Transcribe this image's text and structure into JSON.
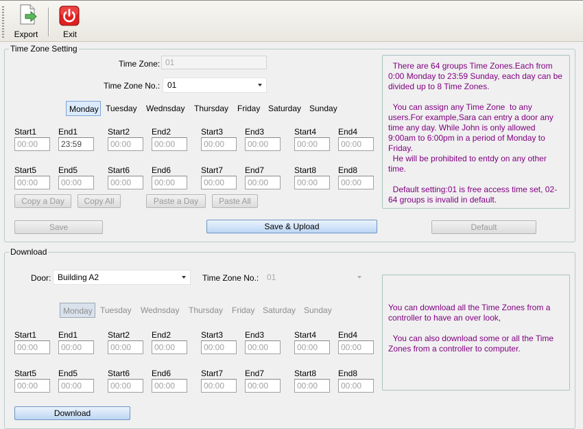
{
  "toolbar": {
    "export_label": "Export",
    "exit_label": "Exit"
  },
  "tz_setting": {
    "title": "Time Zone Setting",
    "time_zone_label": "Time Zone:",
    "time_zone_value": "01",
    "tz_no_label": "Time Zone No.:",
    "tz_no_value": "01",
    "days": [
      "Monday",
      "Tuesday",
      "Wednsday",
      "Thursday",
      "Friday",
      "Saturday",
      "Sunday"
    ],
    "selected_day": "Monday",
    "row1": [
      {
        "s_label": "Start1",
        "e_label": "End1",
        "s_value": "00:00",
        "e_value": "23:59"
      },
      {
        "s_label": "Start2",
        "e_label": "End2",
        "s_value": "00:00",
        "e_value": "00:00"
      },
      {
        "s_label": "Start3",
        "e_label": "End3",
        "s_value": "00:00",
        "e_value": "00:00"
      },
      {
        "s_label": "Start4",
        "e_label": "End4",
        "s_value": "00:00",
        "e_value": "00:00"
      }
    ],
    "row2": [
      {
        "s_label": "Start5",
        "e_label": "End5",
        "s_value": "00:00",
        "e_value": "00:00"
      },
      {
        "s_label": "Start6",
        "e_label": "End6",
        "s_value": "00:00",
        "e_value": "00:00"
      },
      {
        "s_label": "Start7",
        "e_label": "End7",
        "s_value": "00:00",
        "e_value": "00:00"
      },
      {
        "s_label": "Start8",
        "e_label": "End8",
        "s_value": "00:00",
        "e_value": "00:00"
      }
    ],
    "copy_day_label": "Copy a Day",
    "copy_all_label": "Copy All",
    "paste_day_label": "Paste a Day",
    "paste_all_label": "Paste All",
    "save_label": "Save",
    "save_upload_label": "Save & Upload",
    "default_label": "Default",
    "info_text": "  There are 64 groups Time Zones.Each from 0:00 Monday to 23:59 Sunday, each day can be divided up to 8 Time Zones.\n\n  You can assign any Time Zone  to any users.For example,Sara can entry a door any time any day. While John is only allowed 9:00am to 6:00pm in a period of Monday to Friday.\n  He will be prohibited to entdy on any other time.\n\n  Default setting:01 is free access time set, 02-64 groups is invalid in default."
  },
  "download": {
    "title": "Download",
    "door_label": "Door:",
    "door_value": "Building A2",
    "tz_no_label": "Time Zone No.:",
    "tz_no_value": "01",
    "days": [
      "Monday",
      "Tuesday",
      "Wednsday",
      "Thursday",
      "Friday",
      "Saturday",
      "Sunday"
    ],
    "selected_day": "Monday",
    "row1": [
      {
        "s_label": "Start1",
        "e_label": "End1",
        "s_value": "00:00",
        "e_value": "00:00"
      },
      {
        "s_label": "Start2",
        "e_label": "End2",
        "s_value": "00:00",
        "e_value": "00:00"
      },
      {
        "s_label": "Start3",
        "e_label": "End3",
        "s_value": "00:00",
        "e_value": "00:00"
      },
      {
        "s_label": "Start4",
        "e_label": "End4",
        "s_value": "00:00",
        "e_value": "00:00"
      }
    ],
    "row2": [
      {
        "s_label": "Start5",
        "e_label": "End5",
        "s_value": "00:00",
        "e_value": "00:00"
      },
      {
        "s_label": "Start6",
        "e_label": "End6",
        "s_value": "00:00",
        "e_value": "00:00"
      },
      {
        "s_label": "Start7",
        "e_label": "End7",
        "s_value": "00:00",
        "e_value": "00:00"
      },
      {
        "s_label": "Start8",
        "e_label": "End8",
        "s_value": "00:00",
        "e_value": "00:00"
      }
    ],
    "download_label": "Download",
    "info_text": "You can download all the Time Zones from a controller to have an over look,\n\n  You can also download some or all the Time Zones from a controller to computer."
  },
  "colors": {
    "info_text": "#800080",
    "selected_day_bg": "#dcebfc",
    "primary_button": "#bcd6f4"
  },
  "icons": {
    "export": "export-document-arrow-icon",
    "exit": "power-icon"
  }
}
